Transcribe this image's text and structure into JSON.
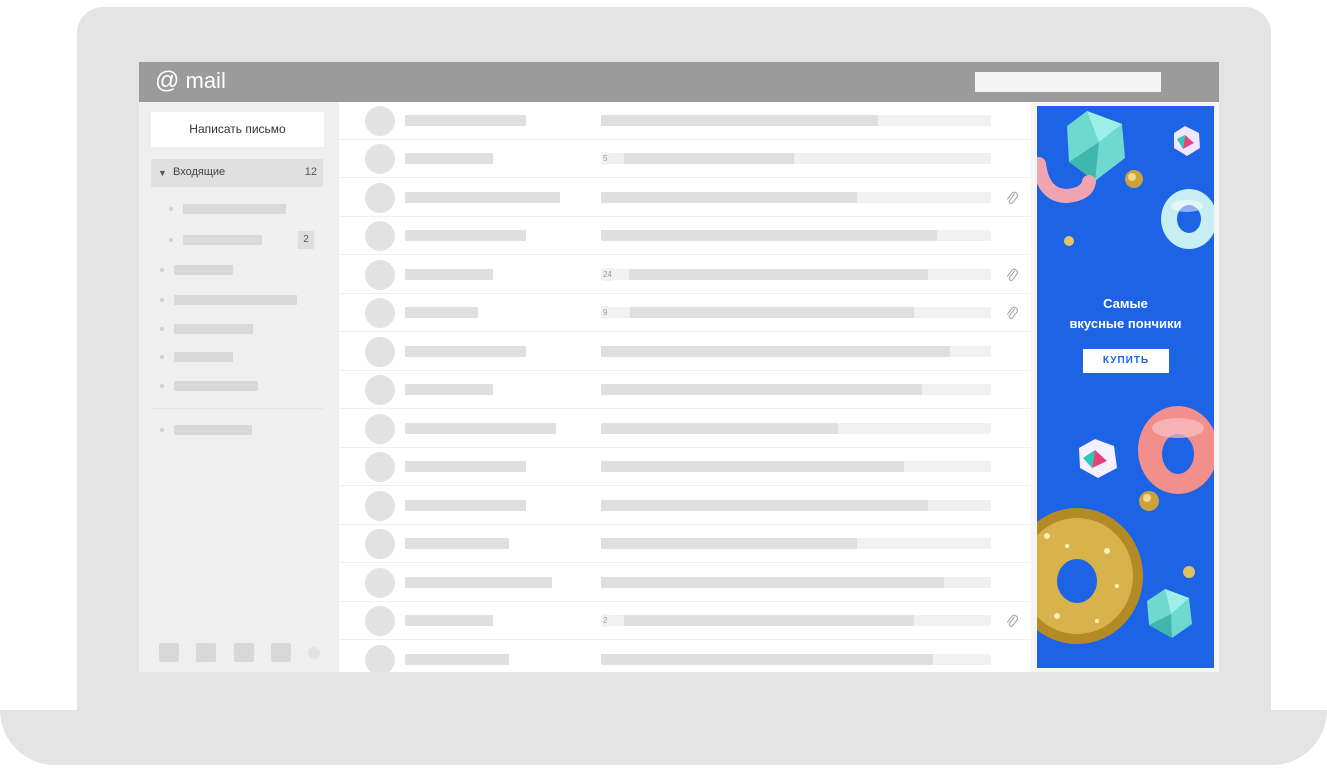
{
  "header": {
    "logo_at": "@",
    "logo_text": "mail"
  },
  "sidebar": {
    "compose_label": "Написать письмо",
    "inbox": {
      "label": "Входящие",
      "count": "12"
    },
    "subfolder_count": "2"
  },
  "messages": {
    "thread_counts": [
      "5",
      "24",
      "9",
      "2"
    ]
  },
  "ad": {
    "title_line1": "Самые",
    "title_line2": "вкусные пончики",
    "button_label": "КУПИТЬ"
  },
  "colors": {
    "header": "#9b9b9b",
    "ad_background": "#1d63e6",
    "placeholder_bar": "#dfdfdf"
  }
}
